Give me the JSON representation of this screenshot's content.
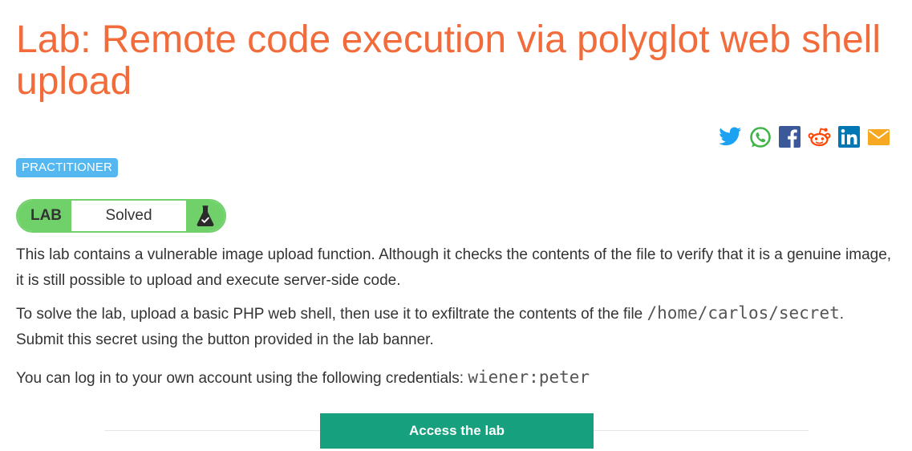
{
  "lab": {
    "title": "Lab: Remote code execution via polyglot web shell upload",
    "level_badge": "PRACTITIONER",
    "status_tag": "LAB",
    "status_text": "Solved"
  },
  "share": {
    "icons": [
      "twitter-icon",
      "whatsapp-icon",
      "facebook-icon",
      "reddit-icon",
      "linkedin-icon",
      "email-icon"
    ]
  },
  "description": {
    "p1": "This lab contains a vulnerable image upload function. Although it checks the contents of the file to verify that it is a genuine image, it is still possible to upload and execute server-side code.",
    "p2_before": "To solve the lab, upload a basic PHP web shell, then use it to exfiltrate the contents of the file ",
    "p2_path": "/home/carlos/secret",
    "p2_after": ". Submit this secret using the button provided in the lab banner.",
    "p3_before": "You can log in to your own account using the following credentials: ",
    "p3_credentials": "wiener:peter"
  },
  "actions": {
    "access_label": "Access the lab"
  },
  "colors": {
    "title": "#f26b3a",
    "badge": "#54b7f0",
    "solved_green": "#70d16b",
    "access_button": "#16a07e"
  }
}
